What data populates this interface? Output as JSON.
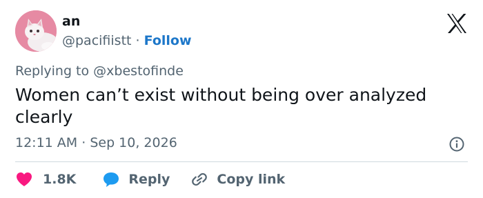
{
  "author": {
    "name": "an",
    "handle": "@pacifiistt",
    "separator": "·",
    "follow_label": "Follow"
  },
  "tweet": {
    "replying_to_prefix": "Replying to",
    "replying_to_handle": "@xbestofinde",
    "text": "Women can’t exist without being over analyzed clearly",
    "time": "12:11 AM",
    "date_separator": "·",
    "date": "Sep 10, 2026"
  },
  "actions": {
    "like_count": "1.8K",
    "reply_label": "Reply",
    "copy_link_label": "Copy link"
  },
  "colors": {
    "like": "#f91880",
    "reply": "#1d9bf0",
    "follow": "#1d77c9",
    "secondary_text": "#536471",
    "divider": "#cfd9de"
  },
  "icons": [
    "x-logo-icon",
    "info-icon",
    "heart-icon",
    "reply-bubble-icon",
    "link-icon"
  ]
}
